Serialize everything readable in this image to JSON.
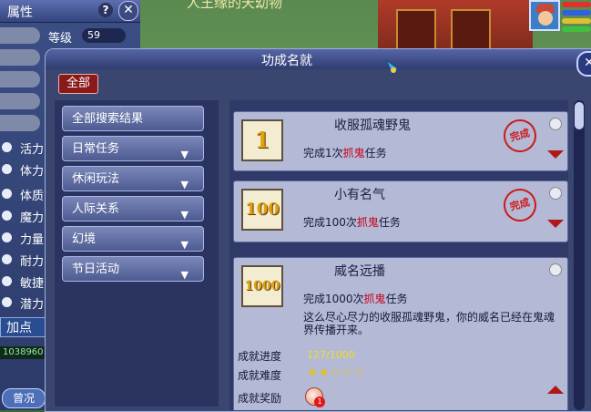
{
  "scene": {
    "banner_fragment": "人王缘的天幼物"
  },
  "attr_panel": {
    "title": "属性",
    "help": "?",
    "close": "✕",
    "level_label": "等级",
    "level_value": "59",
    "stats": [
      "活力",
      "体力",
      "体质",
      "魔力",
      "力量",
      "耐力",
      "敏捷",
      "潜力"
    ],
    "add_point": "加点",
    "money": "1038960",
    "upgrade": "曾况"
  },
  "dialog": {
    "title": "功成名就",
    "close": "✕",
    "all_button": "全部",
    "categories": [
      {
        "label": "全部搜索结果",
        "expandable": false
      },
      {
        "label": "日常任务",
        "expandable": true
      },
      {
        "label": "休闲玩法",
        "expandable": true
      },
      {
        "label": "人际关系",
        "expandable": true
      },
      {
        "label": "幻境",
        "expandable": true
      },
      {
        "label": "节日活动",
        "expandable": true
      }
    ],
    "achievements": [
      {
        "icon_text": "1",
        "name": "收服孤魂野鬼",
        "desc_prefix": "完成1次",
        "desc_highlight": "抓鬼",
        "desc_suffix": "任务",
        "seal": "完成",
        "completed": true,
        "expanded": false
      },
      {
        "icon_text": "100",
        "name": "小有名气",
        "desc_prefix": "完成100次",
        "desc_highlight": "抓鬼",
        "desc_suffix": "任务",
        "seal": "完成",
        "completed": true,
        "expanded": false
      },
      {
        "icon_text": "1000",
        "name": "威名远播",
        "desc_prefix": "完成1000次",
        "desc_highlight": "抓鬼",
        "desc_suffix": "任务",
        "completed": false,
        "expanded": true,
        "long_desc": "这么尽心尽力的收服孤魂野鬼，你的威名已经在鬼魂界传播开来。",
        "progress_label": "成就进度",
        "progress_value": "127/1000",
        "progress_fraction": 0.127,
        "difficulty_label": "成就难度",
        "difficulty_stars": "★★☆☆☆",
        "difficulty_rating": 2,
        "difficulty_max": 5,
        "reward_label": "成就奖励",
        "reward_count": "1"
      }
    ]
  },
  "colors": {
    "panel_bg": "#3a4670",
    "highlight_red": "#c8001a",
    "progress_yellow": "#e8e020",
    "seal_red": "#cc1a1a"
  }
}
